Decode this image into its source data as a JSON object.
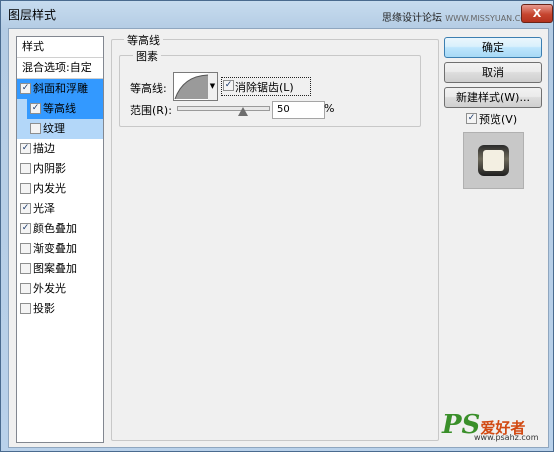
{
  "window": {
    "title": "图层样式",
    "watermark_text": "思缘设计论坛",
    "watermark_url": "WWW.MISSYUAN.COM",
    "close_label": "X"
  },
  "style_list": {
    "header": "样式",
    "blend_options": "混合选项:自定",
    "items": [
      {
        "label": "斜面和浮雕",
        "checked": true,
        "selected": true
      },
      {
        "label": "等高线",
        "checked": true,
        "selected": true
      },
      {
        "label": "纹理",
        "checked": false,
        "selected": false
      },
      {
        "label": "描边",
        "checked": true,
        "selected": false
      },
      {
        "label": "内阴影",
        "checked": false,
        "selected": false
      },
      {
        "label": "内发光",
        "checked": false,
        "selected": false
      },
      {
        "label": "光泽",
        "checked": true,
        "selected": false
      },
      {
        "label": "颜色叠加",
        "checked": true,
        "selected": false
      },
      {
        "label": "渐变叠加",
        "checked": false,
        "selected": false
      },
      {
        "label": "图案叠加",
        "checked": false,
        "selected": false
      },
      {
        "label": "外发光",
        "checked": false,
        "selected": false
      },
      {
        "label": "投影",
        "checked": false,
        "selected": false
      }
    ]
  },
  "contour_panel": {
    "group_title": "等高线",
    "sub_group_title": "图素",
    "contour_label": "等高线:",
    "antialias_label": "消除锯齿(L)",
    "antialias_checked": true,
    "range_label": "范围(R):",
    "range_value": "50",
    "range_unit": "%",
    "range_fraction": 0.5
  },
  "buttons": {
    "ok": "确定",
    "cancel": "取消",
    "new_style": "新建样式(W)...",
    "preview_label": "预览(V)",
    "preview_checked": true
  },
  "logo": {
    "ps": "PS",
    "name": "爱好者",
    "domain": "www.psahz.com"
  }
}
